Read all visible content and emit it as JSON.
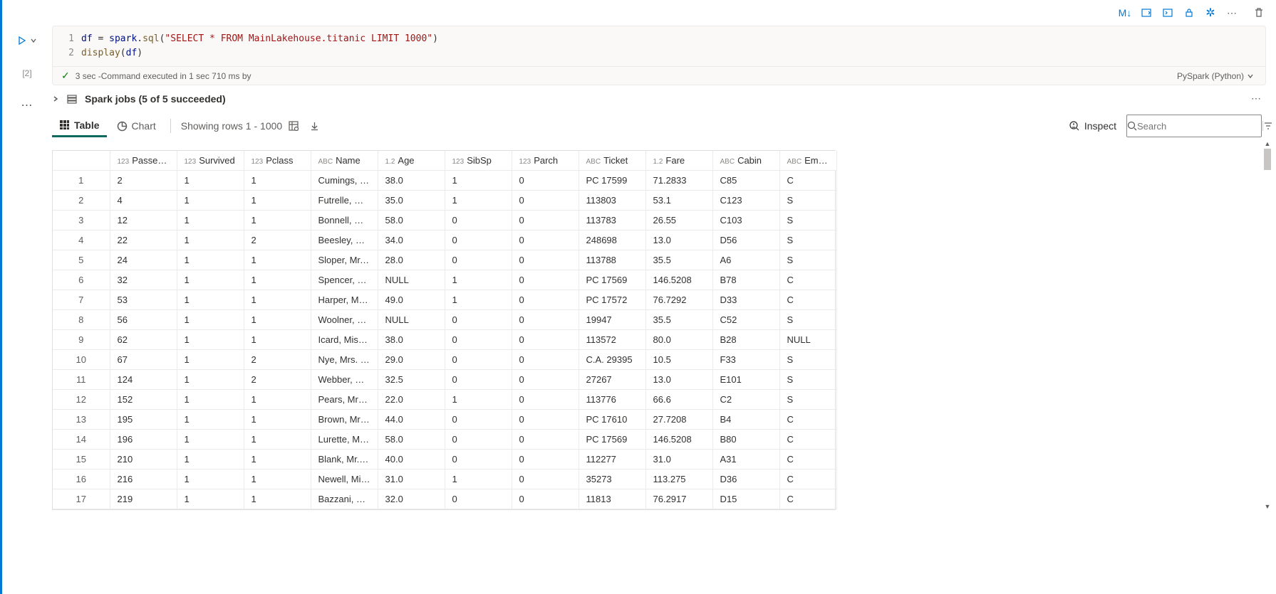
{
  "toolbar": {
    "markdown": "M↓",
    "language": "PySpark (Python)"
  },
  "cell": {
    "exec_count": "[2]",
    "code_line1_var": "df",
    "code_line1_eq": " = ",
    "code_line1_obj": "spark",
    "code_line1_dot": ".",
    "code_line1_fn": "sql",
    "code_line1_paren_open": "(",
    "code_line1_str": "\"SELECT * FROM MainLakehouse.titanic LIMIT 1000\"",
    "code_line1_paren_close": ")",
    "code_line2_fn": "display",
    "code_line2_paren_open": "(",
    "code_line2_arg": "df",
    "code_line2_paren_close": ")",
    "lineno1": "1",
    "lineno2": "2",
    "status_time": "3 sec",
    "status_text": " -Command executed in 1 sec 710 ms by"
  },
  "spark": {
    "label": "Spark jobs (5 of 5 succeeded)"
  },
  "tabs": {
    "table": "Table",
    "chart": "Chart",
    "rows_info": "Showing rows 1 - 1000",
    "inspect": "Inspect",
    "search_placeholder": "Search"
  },
  "table": {
    "columns": [
      {
        "dtype": "",
        "label": ""
      },
      {
        "dtype": "123",
        "label": "Passenger…"
      },
      {
        "dtype": "123",
        "label": "Survived"
      },
      {
        "dtype": "123",
        "label": "Pclass"
      },
      {
        "dtype": "ABC",
        "label": "Name"
      },
      {
        "dtype": "1.2",
        "label": "Age"
      },
      {
        "dtype": "123",
        "label": "SibSp"
      },
      {
        "dtype": "123",
        "label": "Parch"
      },
      {
        "dtype": "ABC",
        "label": "Ticket"
      },
      {
        "dtype": "1.2",
        "label": "Fare"
      },
      {
        "dtype": "ABC",
        "label": "Cabin"
      },
      {
        "dtype": "ABC",
        "label": "Embarked"
      }
    ],
    "rows": [
      {
        "n": "1",
        "pid": "2",
        "surv": "1",
        "pcl": "1",
        "name": "Cumings, M…",
        "age": "38.0",
        "sib": "1",
        "par": "0",
        "tick": "PC 17599",
        "fare": "71.2833",
        "cab": "C85",
        "emb": "C"
      },
      {
        "n": "2",
        "pid": "4",
        "surv": "1",
        "pcl": "1",
        "name": "Futrelle, Mrs.…",
        "age": "35.0",
        "sib": "1",
        "par": "0",
        "tick": "113803",
        "fare": "53.1",
        "cab": "C123",
        "emb": "S"
      },
      {
        "n": "3",
        "pid": "12",
        "surv": "1",
        "pcl": "1",
        "name": "Bonnell, Mis…",
        "age": "58.0",
        "sib": "0",
        "par": "0",
        "tick": "113783",
        "fare": "26.55",
        "cab": "C103",
        "emb": "S"
      },
      {
        "n": "4",
        "pid": "22",
        "surv": "1",
        "pcl": "2",
        "name": "Beesley, Mr.…",
        "age": "34.0",
        "sib": "0",
        "par": "0",
        "tick": "248698",
        "fare": "13.0",
        "cab": "D56",
        "emb": "S"
      },
      {
        "n": "5",
        "pid": "24",
        "surv": "1",
        "pcl": "1",
        "name": "Sloper, Mr. …",
        "age": "28.0",
        "sib": "0",
        "par": "0",
        "tick": "113788",
        "fare": "35.5",
        "cab": "A6",
        "emb": "S"
      },
      {
        "n": "6",
        "pid": "32",
        "surv": "1",
        "pcl": "1",
        "name": "Spencer, Mr.…",
        "age": "NULL",
        "sib": "1",
        "par": "0",
        "tick": "PC 17569",
        "fare": "146.5208",
        "cab": "B78",
        "emb": "C"
      },
      {
        "n": "7",
        "pid": "53",
        "surv": "1",
        "pcl": "1",
        "name": "Harper, Mrs.…",
        "age": "49.0",
        "sib": "1",
        "par": "0",
        "tick": "PC 17572",
        "fare": "76.7292",
        "cab": "D33",
        "emb": "C"
      },
      {
        "n": "8",
        "pid": "56",
        "surv": "1",
        "pcl": "1",
        "name": "Woolner, M…",
        "age": "NULL",
        "sib": "0",
        "par": "0",
        "tick": "19947",
        "fare": "35.5",
        "cab": "C52",
        "emb": "S"
      },
      {
        "n": "9",
        "pid": "62",
        "surv": "1",
        "pcl": "1",
        "name": "Icard, Miss. …",
        "age": "38.0",
        "sib": "0",
        "par": "0",
        "tick": "113572",
        "fare": "80.0",
        "cab": "B28",
        "emb": "NULL"
      },
      {
        "n": "10",
        "pid": "67",
        "surv": "1",
        "pcl": "2",
        "name": "Nye, Mrs. (E…",
        "age": "29.0",
        "sib": "0",
        "par": "0",
        "tick": "C.A. 29395",
        "fare": "10.5",
        "cab": "F33",
        "emb": "S"
      },
      {
        "n": "11",
        "pid": "124",
        "surv": "1",
        "pcl": "2",
        "name": "Webber, Mi…",
        "age": "32.5",
        "sib": "0",
        "par": "0",
        "tick": "27267",
        "fare": "13.0",
        "cab": "E101",
        "emb": "S"
      },
      {
        "n": "12",
        "pid": "152",
        "surv": "1",
        "pcl": "1",
        "name": "Pears, Mrs. …",
        "age": "22.0",
        "sib": "1",
        "par": "0",
        "tick": "113776",
        "fare": "66.6",
        "cab": "C2",
        "emb": "S"
      },
      {
        "n": "13",
        "pid": "195",
        "surv": "1",
        "pcl": "1",
        "name": "Brown, Mrs. …",
        "age": "44.0",
        "sib": "0",
        "par": "0",
        "tick": "PC 17610",
        "fare": "27.7208",
        "cab": "B4",
        "emb": "C"
      },
      {
        "n": "14",
        "pid": "196",
        "surv": "1",
        "pcl": "1",
        "name": "Lurette, Mis…",
        "age": "58.0",
        "sib": "0",
        "par": "0",
        "tick": "PC 17569",
        "fare": "146.5208",
        "cab": "B80",
        "emb": "C"
      },
      {
        "n": "15",
        "pid": "210",
        "surv": "1",
        "pcl": "1",
        "name": "Blank, Mr. H…",
        "age": "40.0",
        "sib": "0",
        "par": "0",
        "tick": "112277",
        "fare": "31.0",
        "cab": "A31",
        "emb": "C"
      },
      {
        "n": "16",
        "pid": "216",
        "surv": "1",
        "pcl": "1",
        "name": "Newell, Mis…",
        "age": "31.0",
        "sib": "1",
        "par": "0",
        "tick": "35273",
        "fare": "113.275",
        "cab": "D36",
        "emb": "C"
      },
      {
        "n": "17",
        "pid": "219",
        "surv": "1",
        "pcl": "1",
        "name": "Bazzani, Mis…",
        "age": "32.0",
        "sib": "0",
        "par": "0",
        "tick": "11813",
        "fare": "76.2917",
        "cab": "D15",
        "emb": "C"
      }
    ]
  }
}
